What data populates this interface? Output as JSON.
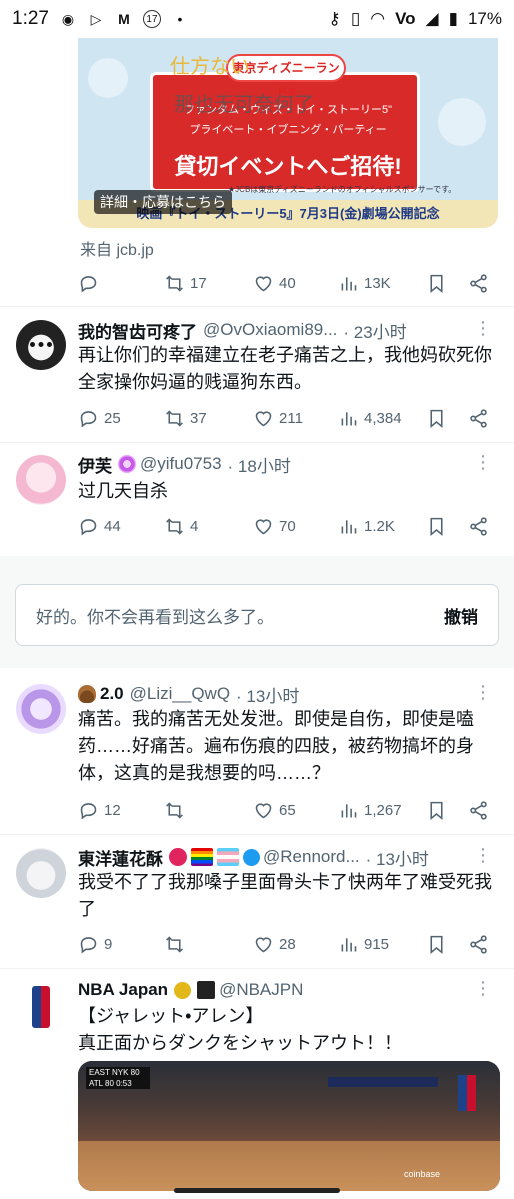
{
  "status_bar": {
    "time": "1:27",
    "dot": "•",
    "battery": "17%",
    "icons_left": [
      "notification-a-icon",
      "play-icon",
      "gmail-icon",
      "calendar-17-icon"
    ],
    "icons_right": [
      "key-icon",
      "vibrate-icon",
      "wifi-icon",
      "volte-icon",
      "signal-icon",
      "battery-icon"
    ]
  },
  "promo": {
    "overlay_top": "仕方ない",
    "overlay_mid": "那也无可奈何了",
    "logo": "東京ディズニーランド®",
    "line1": "ファンタム・ウィズ・トイ・ストーリー5\"",
    "line2": "プライベート・イブニング・パーティー",
    "line3": "貸切イベントへご招待!",
    "small": "★JCBは東京ディズニーランドのオフィシャルスポンサーです。",
    "bottom": "映画『トイ・ストーリー5』7月3日(金)劇場公開記念",
    "detail_chip": "詳細・応募はこちら",
    "source": "来自 jcb.jp"
  },
  "tweets": [
    {
      "id": "promo",
      "stats": {
        "reply": "",
        "retweet": "17",
        "like": "40",
        "views": "13K"
      }
    },
    {
      "id": "t1",
      "name": "我的智齿可疼了",
      "handle": "@OvOxiaomi89...",
      "time": "· 23小时",
      "text": "再让你们的幸福建立在老子痛苦之上，我他妈砍死你全家操你妈逼的贱逼狗东西。",
      "stats": {
        "reply": "25",
        "retweet": "37",
        "like": "211",
        "views": "4,384"
      }
    },
    {
      "id": "t2",
      "name": "伊芙",
      "handle": "@yifu0753",
      "time": "· 18小时",
      "text": "过几天自杀",
      "stats": {
        "reply": "44",
        "retweet": "4",
        "like": "70",
        "views": "1.2K"
      }
    },
    {
      "id": "t3",
      "name": "2.0",
      "handle": "@Lizi__QwQ",
      "time": "· 13小时",
      "text": "痛苦。我的痛苦无处发泄。即使是自伤，即使是嗑药……好痛苦。遍布伤痕的四肢，被药物搞坏的身体，这真的是我想要的吗……？",
      "stats": {
        "reply": "12",
        "retweet": "",
        "like": "65",
        "views": "1,267"
      }
    },
    {
      "id": "t4",
      "name": "東洋蓮花酥",
      "handle": "@Rennord...",
      "time": "· 13小时",
      "text": "我受不了了我那嗓子里面骨头卡了快两年了难受死我了",
      "stats": {
        "reply": "9",
        "retweet": "",
        "like": "28",
        "views": "915"
      }
    },
    {
      "id": "t5",
      "name": "NBA Japan",
      "handle": "@NBAJPN",
      "time": "",
      "text": "【ジャレット•アレン】\n真正面からダンクをシャットアウト！！"
    }
  ],
  "hidden_notice": {
    "message": "好的。你不会再看到这么多了。",
    "undo": "撤销"
  },
  "media": {
    "brand": "coinbase",
    "score_lines": [
      "EAST  NYK  80",
      "ATL   80  0:53"
    ]
  },
  "colors": {
    "text": "#0f1419",
    "muted": "#536471",
    "divider": "#eff3f4",
    "gold": "#e2b719",
    "verified_blue": "#1d9bf0"
  }
}
